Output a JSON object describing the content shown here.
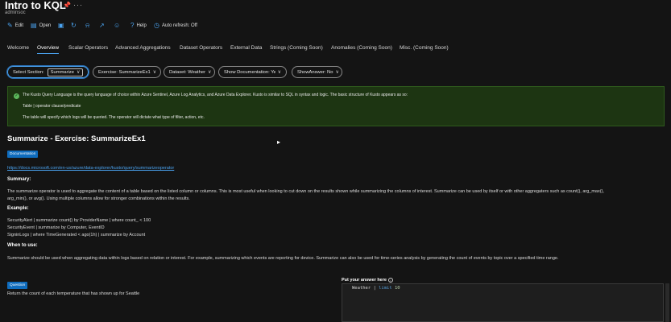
{
  "header": {
    "title": "Intro to KQL",
    "subtitle": "adminsoc"
  },
  "toolbar": {
    "items": [
      {
        "label": "Edit",
        "icon": "pencil-icon"
      },
      {
        "label": "Open",
        "icon": "folder-icon"
      },
      {
        "label": "",
        "icon": "save-icon"
      },
      {
        "label": "",
        "icon": "refresh-icon"
      },
      {
        "label": "",
        "icon": "bell-icon"
      },
      {
        "label": "",
        "icon": "share-icon"
      },
      {
        "label": "",
        "icon": "smiley-icon"
      },
      {
        "label": "Help",
        "icon": "help-icon"
      },
      {
        "label": "Auto refresh: Off",
        "icon": "clock-icon"
      }
    ]
  },
  "tabs": [
    {
      "label": "Welcome"
    },
    {
      "label": "Overview",
      "active": true
    },
    {
      "label": "Scalar Operators"
    },
    {
      "label": "Advanced Aggregations"
    },
    {
      "label": "Dataset Operators"
    },
    {
      "label": "External Data"
    },
    {
      "label": "Strings (Coming Soon)"
    },
    {
      "label": "Anomalies (Coming Soon)"
    },
    {
      "label": "Misc. (Coming Soon)"
    }
  ],
  "filters": {
    "section_label": "Select Section:",
    "section_value": "Summarize",
    "exercise": "Exercise: SummarizeEx1",
    "dataset": "Dataset: Weather",
    "show_documentation": "Show Documentation: Yes",
    "show_answer": "ShowAnswer: No"
  },
  "info": {
    "line1": "The Kusto Query Language is the query language of choice within Azure Sentinel, Azure Log Analytics, and Azure Data Explorer. Kusto is similar to SQL in syntax and logic. The basic structure of Kusto appears as so:",
    "line2": "Table | operator clause/predicate",
    "line3": "The table will specify which logs will be queried. The operator will dictate what type of filter, action, etc."
  },
  "exercise": {
    "title": "Summarize - Exercise: SummarizeEx1",
    "documentation_badge": "Documentation",
    "doc_link": "https://docs.microsoft.com/en-us/azure/data-explorer/kusto/query/summarizeoperator",
    "summary_heading": "Summary:",
    "summary_line1": "The summarize operator is used to aggregate the content of a table based on the listed column or columns. This is most useful when looking to cut down on the results shown while summarizing the columns of interest. Summarize can be used by itself or with other aggregaters such as count(), arg_max(),",
    "summary_line2": "arg_min(), or avg(). Using multiple columns allow for stronger combinations within the results.",
    "example_heading": "Example:",
    "example_lines": [
      "SecurityAlert | summarize count() by ProviderName | where count_ < 100",
      "SecurityEvent | summarize by Computer, EventID",
      "SigninLogs | where TimeGenerated < ago(1h) | summarize by Account"
    ],
    "when_heading": "When to use:",
    "when_text": "Summarize should be used when aggregating data within logs based on relation or interest. For example, summarizing which events are reporting for device. Summarize can also be used for time-series analysis by generating the count of events by topic over a specified time range."
  },
  "question": {
    "badge": "Question",
    "text": "Return the count of each temperature that has shown up for Seattle"
  },
  "answer": {
    "label": "Put your answer here",
    "code_table": "Weather",
    "code_pipe": "|",
    "code_kw": "limit",
    "code_num": "10"
  }
}
